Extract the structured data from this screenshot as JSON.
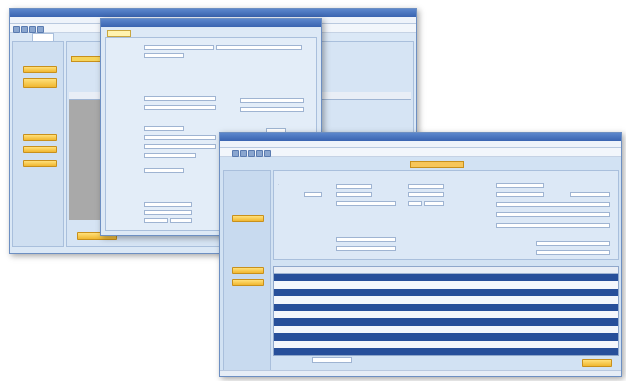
{
  "back_window": {
    "title": "",
    "menus": [
      "",
      "",
      "",
      "",
      "",
      ""
    ],
    "tab": "",
    "sidebar_buttons": [
      "",
      "",
      "",
      "",
      ""
    ],
    "footer_button": ""
  },
  "dialog": {
    "title": "",
    "tab": "",
    "fields": [
      "",
      "",
      "",
      "",
      "",
      "",
      "",
      "",
      "",
      "",
      "",
      "",
      "",
      ""
    ]
  },
  "front_window": {
    "title": "",
    "menus": [
      "",
      "",
      "",
      "",
      "",
      "",
      "",
      "",
      "",
      "",
      "",
      ""
    ],
    "form_title": "",
    "left_buttons": [
      "",
      "",
      ""
    ],
    "section_labels": [
      "",
      "",
      "",
      ""
    ],
    "table": {
      "columns": [
        "",
        "",
        "",
        "",
        "",
        "",
        "",
        "",
        ""
      ],
      "rows": [
        [
          "",
          "",
          "",
          "",
          "",
          "",
          "",
          "",
          ""
        ],
        [
          "",
          "",
          "",
          "",
          "",
          "",
          "",
          "",
          ""
        ],
        [
          "",
          "",
          "",
          "",
          "",
          "",
          "",
          "",
          ""
        ],
        [
          "",
          "",
          "",
          "",
          "",
          "",
          "",
          "",
          ""
        ],
        [
          "",
          "",
          "",
          "",
          "",
          "",
          "",
          "",
          ""
        ],
        [
          "",
          "",
          "",
          "",
          "",
          "",
          "",
          "",
          ""
        ],
        [
          "",
          "",
          "",
          "",
          "",
          "",
          "",
          "",
          ""
        ],
        [
          "",
          "",
          "",
          "",
          "",
          "",
          "",
          "",
          ""
        ],
        [
          "",
          "",
          "",
          "",
          "",
          "",
          "",
          "",
          ""
        ],
        [
          "",
          "",
          "",
          "",
          "",
          "",
          "",
          "",
          ""
        ],
        [
          "",
          "",
          "",
          "",
          "",
          "",
          "",
          "",
          ""
        ]
      ]
    },
    "ok_button": ""
  },
  "colors": {
    "accent_gold": "#f0b730",
    "row_dark": "#274f9a",
    "title_blue": "#3a64b0"
  }
}
